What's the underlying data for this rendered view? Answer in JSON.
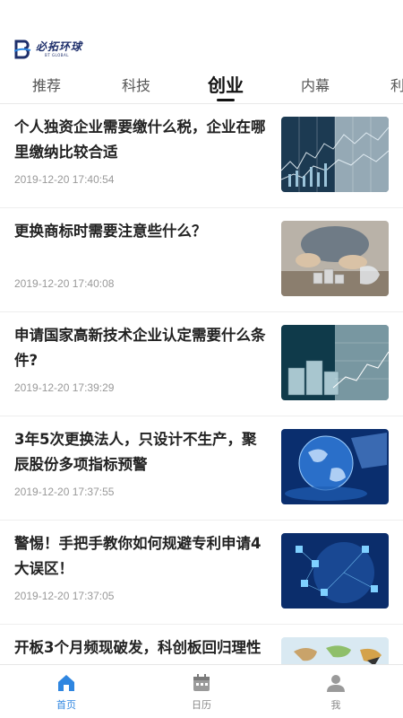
{
  "app": {
    "logo_cn": "必拓环球",
    "logo_en": "BT GLOBAL",
    "brand_color": "#1e2f6b",
    "accent_color": "#2f86e0"
  },
  "tabs": [
    {
      "label": "推荐",
      "active": false
    },
    {
      "label": "科技",
      "active": false
    },
    {
      "label": "创业",
      "active": true
    },
    {
      "label": "内幕",
      "active": false
    },
    {
      "label": "利",
      "active": false
    }
  ],
  "articles": [
    {
      "title": "个人独资企业需要缴什么税，企业在哪里缴纳比较合适",
      "time": "2019-12-20 17:40:54",
      "image": "stock-chart-image"
    },
    {
      "title": "更换商标时需要注意些什么？",
      "time": "2019-12-20 17:40:08",
      "image": "coins-hand-image"
    },
    {
      "title": "申请国家高新技术企业认定需要什么条件?",
      "time": "2019-12-20 17:39:29",
      "image": "coin-stacks-chart-image"
    },
    {
      "title": "3年5次更换法人，只设计不生产，聚辰股份多项指标预警",
      "time": "2019-12-20 17:37:55",
      "image": "globe-image"
    },
    {
      "title": "警惕！手把手教你如何规避专利申请4大误区！",
      "time": "2019-12-20 17:37:05",
      "image": "network-globe-image"
    },
    {
      "title": "开板3个月频现破发，科创板回归理性",
      "time": "",
      "image": "world-map-image"
    }
  ],
  "tabbar": [
    {
      "label": "首页",
      "icon": "home-icon",
      "active": true
    },
    {
      "label": "日历",
      "icon": "calendar-icon",
      "active": false
    },
    {
      "label": "我",
      "icon": "user-icon",
      "active": false
    }
  ]
}
